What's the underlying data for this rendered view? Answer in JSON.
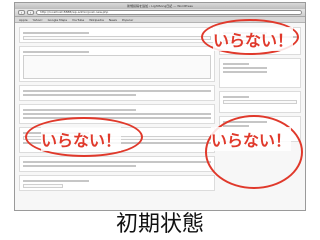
{
  "browser": {
    "window_title": "新規投稿を追加 ‹ LightSong日記 — WordPress",
    "url": "http://localhost:8888/wp-admin/post-new.php",
    "bookmarks": [
      "Apple",
      "Yahoo!",
      "Google Maps",
      "YouTube",
      "Wikipedia",
      "News",
      "Popular"
    ],
    "back_label": "‹",
    "forward_label": "›"
  },
  "callouts": {
    "top_right": "いらない！",
    "bottom_left": "いらない！",
    "bottom_right": "いらない！"
  },
  "caption": "初期状態",
  "colors": {
    "callout": "#e0392b"
  }
}
